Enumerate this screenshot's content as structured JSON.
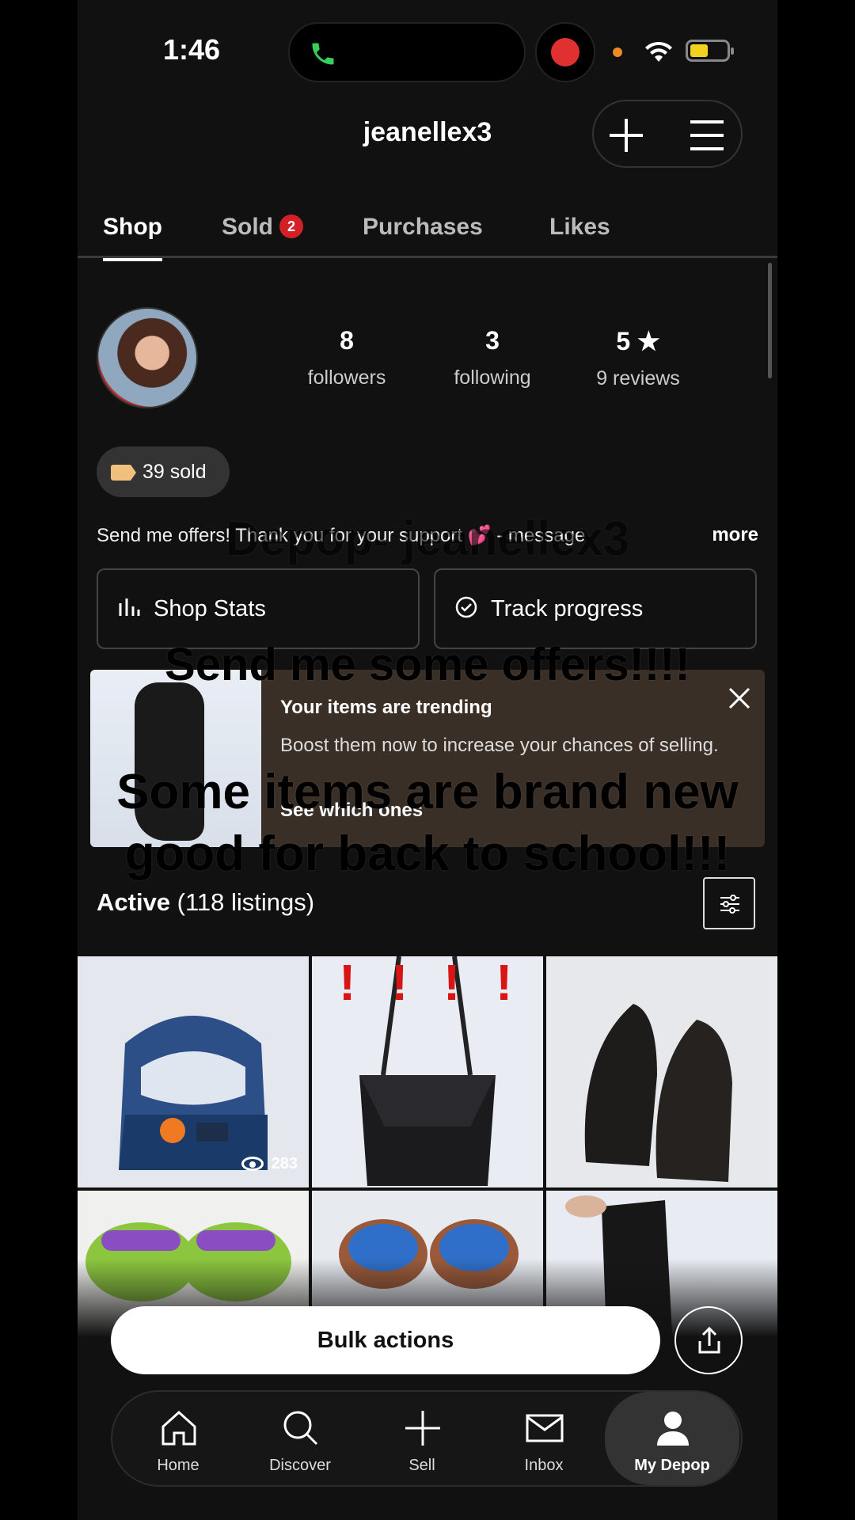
{
  "status": {
    "time": "1:46"
  },
  "header": {
    "username": "jeanellex3"
  },
  "tabs": [
    {
      "label": "Shop",
      "active": true
    },
    {
      "label": "Sold",
      "badge": "2"
    },
    {
      "label": "Purchases"
    },
    {
      "label": "Likes"
    }
  ],
  "profile": {
    "stats": [
      {
        "value": "8",
        "label": "followers"
      },
      {
        "value": "3",
        "label": "following"
      },
      {
        "value": "5 ★",
        "label": "9 reviews"
      }
    ],
    "sold_pill": "39 sold",
    "bio": "Send me offers! Thank you for your support 💕 - message",
    "bio_more": "more"
  },
  "actions": {
    "shop_stats": "Shop Stats",
    "track_progress": "Track progress"
  },
  "trending": {
    "title": "Your items are trending",
    "body": "Boost them now to increase your chances of selling.",
    "link": "See which ones"
  },
  "overlay_text": {
    "line1": "Depop- jeanellex3",
    "line2": "Send me some offers!!!!",
    "line3": "Some items are brand new good for back to school!!!"
  },
  "active": {
    "label": "Active",
    "count": "(118 listings)"
  },
  "listings": [
    {
      "name": "shark-backpack",
      "views": "283"
    },
    {
      "name": "black-quilted-bag",
      "marks": "! ! ! !"
    },
    {
      "name": "black-clogs"
    },
    {
      "name": "crocs-pair"
    },
    {
      "name": "blue-crocs"
    },
    {
      "name": "black-boot"
    }
  ],
  "bulk": {
    "label": "Bulk actions"
  },
  "nav": [
    {
      "label": "Home",
      "icon": "home-icon"
    },
    {
      "label": "Discover",
      "icon": "search-icon"
    },
    {
      "label": "Sell",
      "icon": "plus-icon"
    },
    {
      "label": "Inbox",
      "icon": "mail-icon"
    },
    {
      "label": "My Depop",
      "icon": "person-icon",
      "selected": true
    }
  ],
  "colors": {
    "badge": "#d32027",
    "trending_bg": "#3a2f27",
    "sold_tag": "#f2c07e"
  }
}
